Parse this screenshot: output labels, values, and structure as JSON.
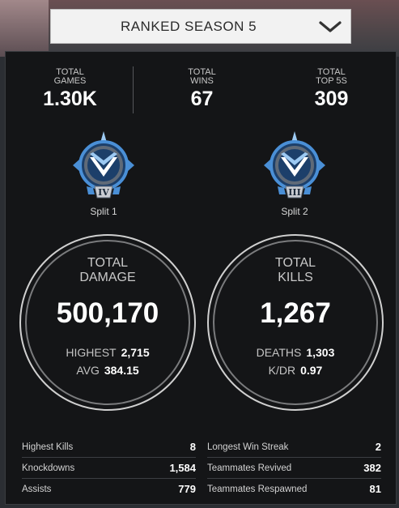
{
  "season": {
    "label": "RANKED SEASON 5"
  },
  "summary": [
    {
      "label_top": "TOTAL",
      "label_bottom": "GAMES",
      "value": "1.30K"
    },
    {
      "label_top": "TOTAL",
      "label_bottom": "WINS",
      "value": "67"
    },
    {
      "label_top": "TOTAL",
      "label_bottom": "TOP 5S",
      "value": "309"
    }
  ],
  "splits": [
    {
      "name": "Split 1",
      "tier": "IV"
    },
    {
      "name": "Split 2",
      "tier": "III"
    }
  ],
  "damage": {
    "title_line1": "TOTAL",
    "title_line2": "DAMAGE",
    "value": "500,170",
    "highest_label": "HIGHEST",
    "highest_value": "2,715",
    "avg_label": "AVG",
    "avg_value": "384.15"
  },
  "kills": {
    "title_line1": "TOTAL",
    "title_line2": "KILLS",
    "value": "1,267",
    "deaths_label": "DEATHS",
    "deaths_value": "1,303",
    "kdr_label": "K/DR",
    "kdr_value": "0.97"
  },
  "stats_left": [
    {
      "label": "Highest Kills",
      "value": "8"
    },
    {
      "label": "Knockdowns",
      "value": "1,584"
    },
    {
      "label": "Assists",
      "value": "779"
    }
  ],
  "stats_right": [
    {
      "label": "Longest Win Streak",
      "value": "2"
    },
    {
      "label": "Teammates Revived",
      "value": "382"
    },
    {
      "label": "Teammates Respawned",
      "value": "81"
    }
  ],
  "colors": {
    "badge_blue": "#4a8fd6",
    "badge_light": "#9cc9f2",
    "badge_dark": "#1c3f6a",
    "badge_steel": "#5f6a78"
  }
}
